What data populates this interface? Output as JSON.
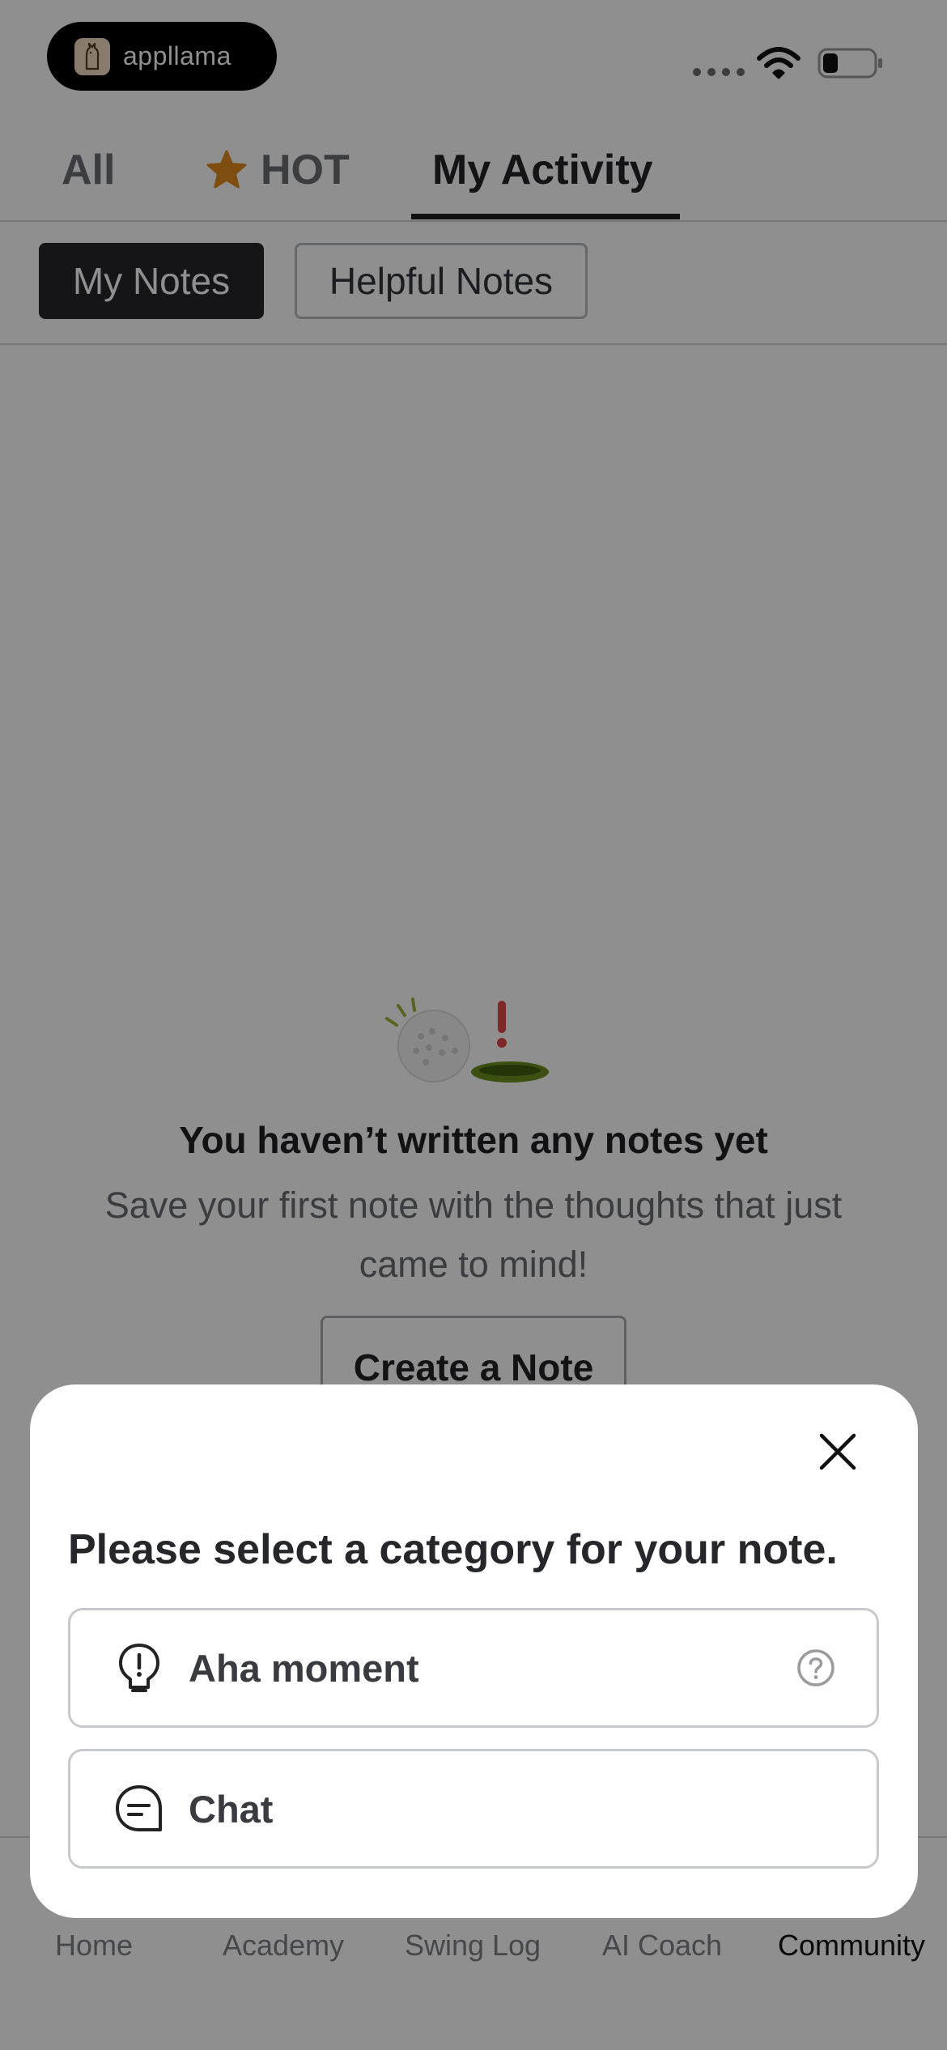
{
  "status_bar": {
    "app_name": "appllama",
    "icons": [
      "appllama-logo-icon",
      "cellular-signal-icon",
      "wifi-icon",
      "battery-icon"
    ]
  },
  "top_tabs": [
    {
      "label": "All",
      "active": false
    },
    {
      "label": "HOT",
      "active": false,
      "icon": "star-icon"
    },
    {
      "label": "My Activity",
      "active": true
    }
  ],
  "sub_tabs": [
    {
      "label": "My Notes",
      "active": true
    },
    {
      "label": "Helpful Notes",
      "active": false
    }
  ],
  "empty_state": {
    "illustration": "golf-ball-hole-illustration",
    "title": "You haven’t written any notes yet",
    "description": "Save your first note with the thoughts that just came to mind!",
    "button_label": "Create a Note"
  },
  "bottom_nav": [
    {
      "label": "Home",
      "active": false
    },
    {
      "label": "Academy",
      "active": false
    },
    {
      "label": "Swing Log",
      "active": false
    },
    {
      "label": "AI Coach",
      "active": false
    },
    {
      "label": "Community",
      "active": true
    }
  ],
  "modal": {
    "title": "Please select a category for your note.",
    "close_icon": "close-icon",
    "options": [
      {
        "label": "Aha moment",
        "icon": "lightbulb-alert-icon",
        "help_icon": "question-circle-icon"
      },
      {
        "label": "Chat",
        "icon": "chat-bubble-icon"
      }
    ]
  },
  "colors": {
    "active_dark": "#26272b",
    "star": "#e08a1e",
    "overlay": "rgba(0,0,0,0.44)",
    "muted_text": "#6a6c72"
  }
}
